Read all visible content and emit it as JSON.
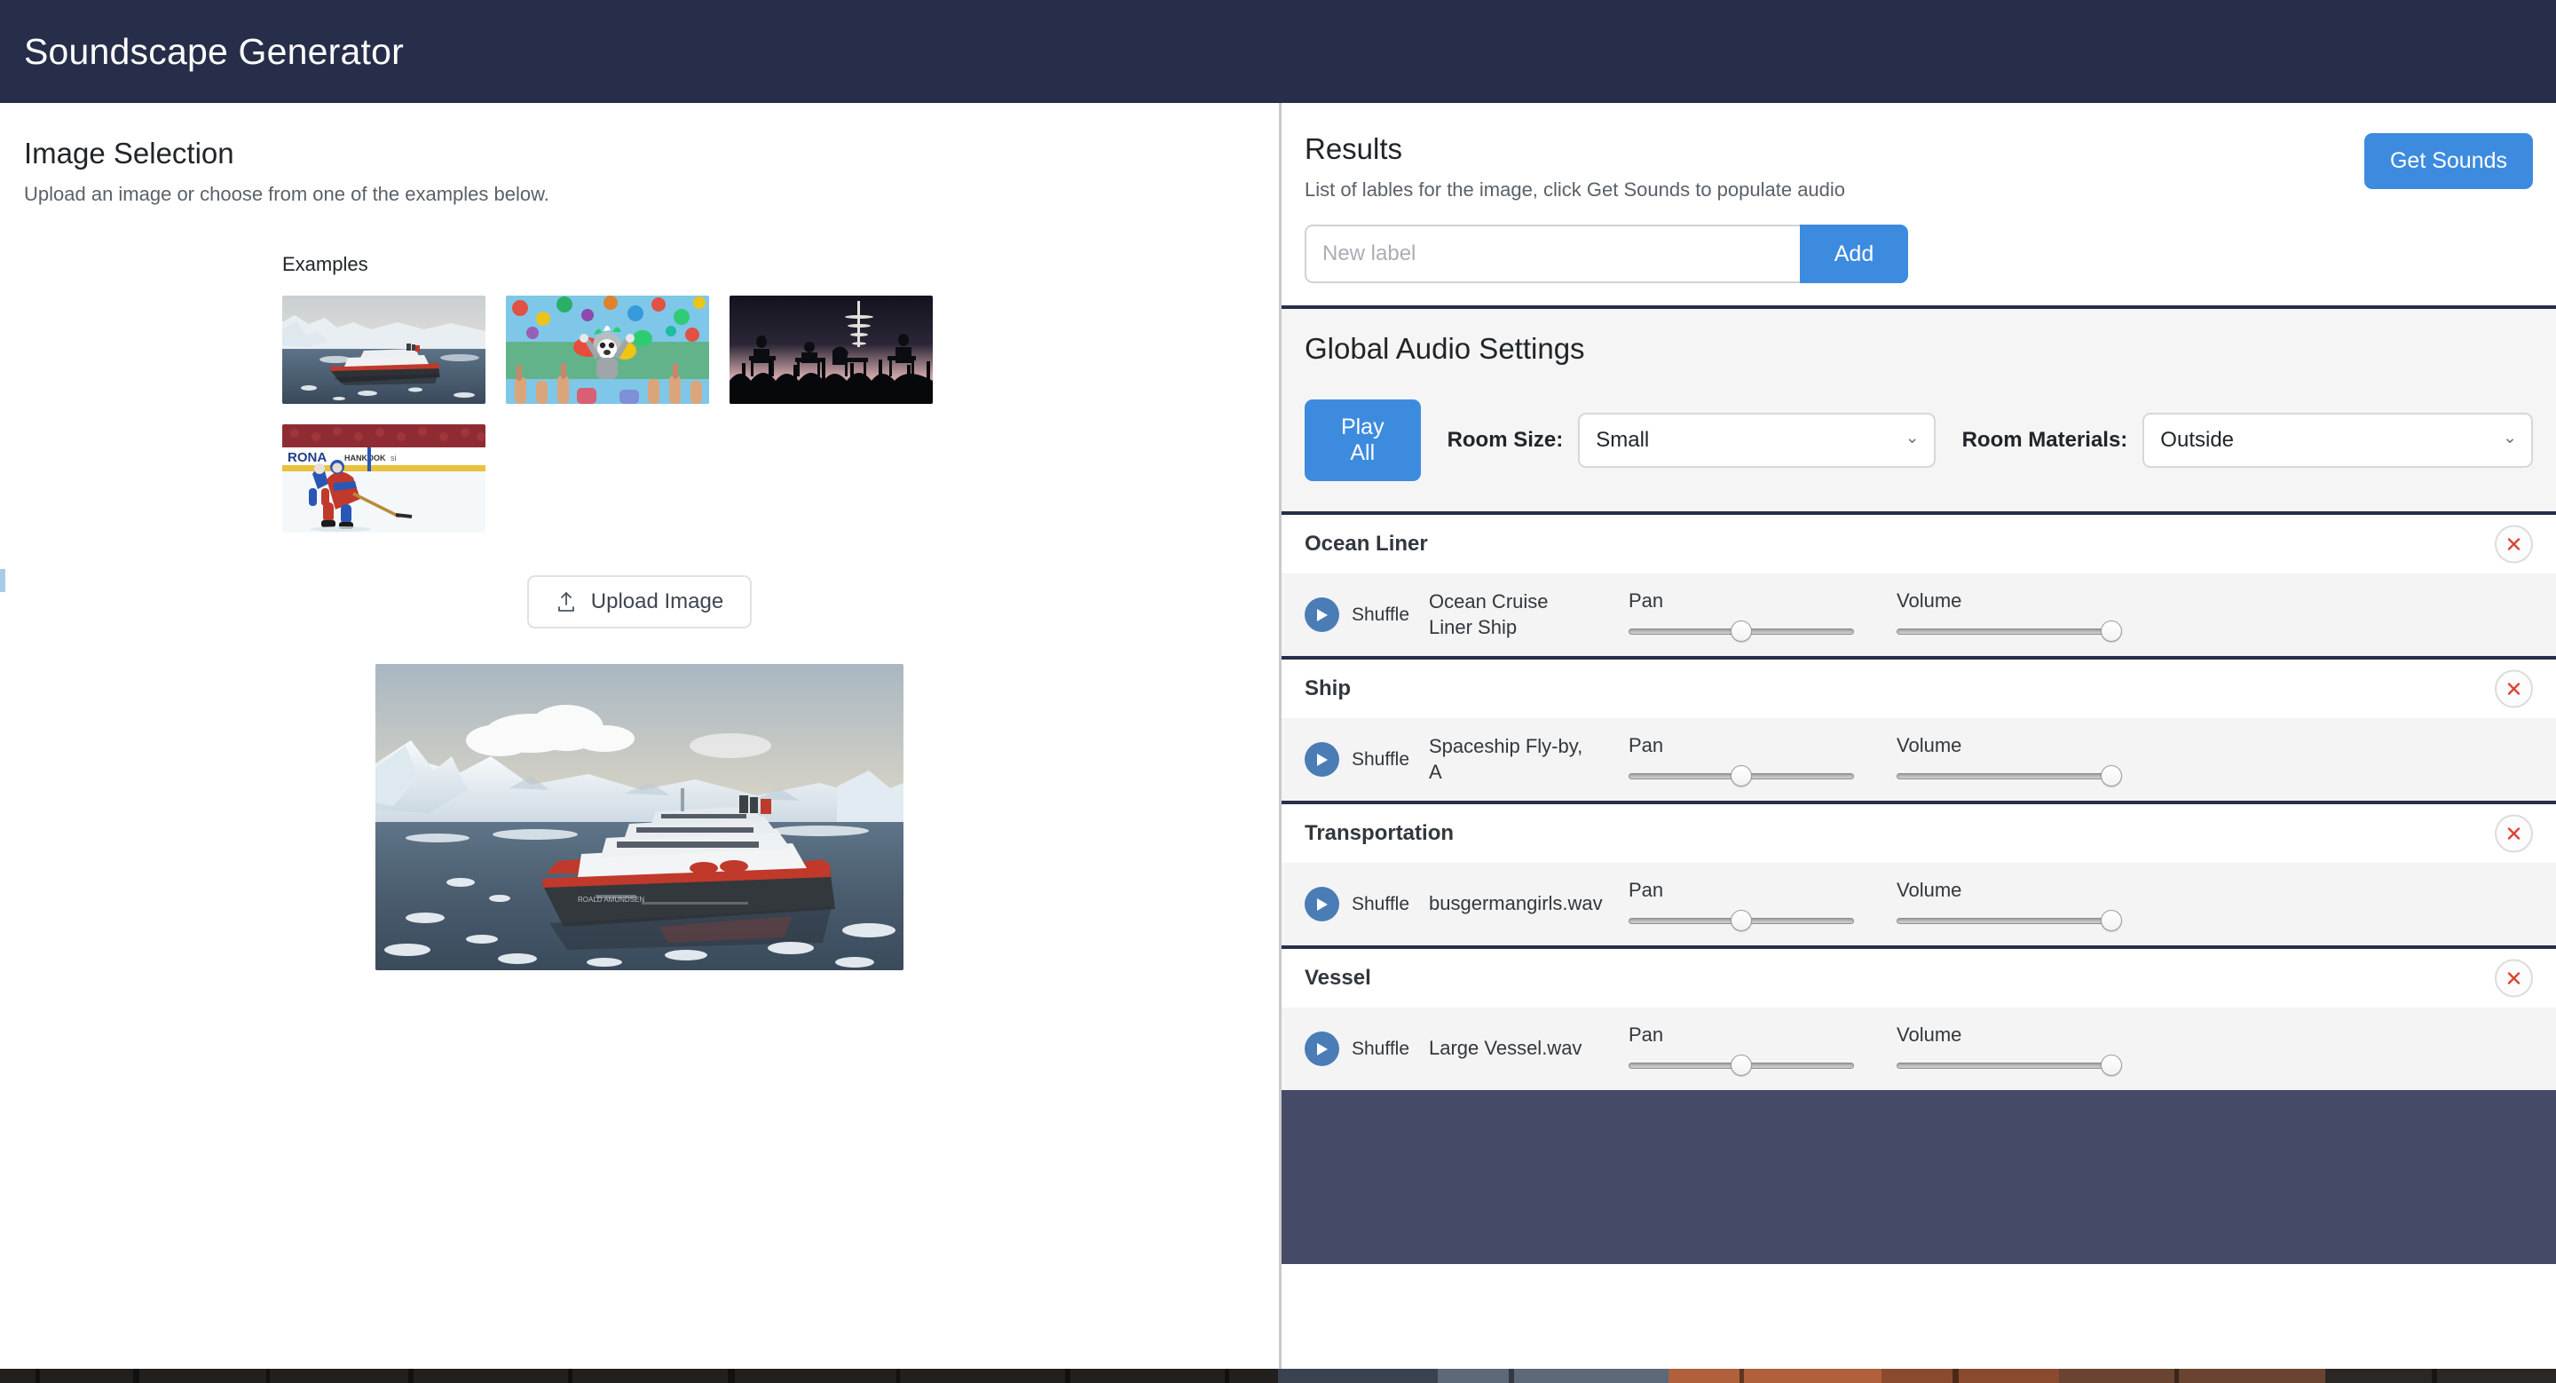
{
  "header": {
    "title": "Soundscape Generator",
    "background": "#272E4A"
  },
  "left_panel": {
    "title": "Image Selection",
    "subtitle": "Upload an image or choose from one of the examples below.",
    "examples_label": "Examples",
    "examples": [
      {
        "name": "example-cruise-ship",
        "alt": "Arctic cruise ship among icebergs"
      },
      {
        "name": "example-mascot-party",
        "alt": "Costumed lemur mascot with cheering kids and balloons"
      },
      {
        "name": "example-concert-crowd",
        "alt": "Concert stage silhouettes with crowd"
      },
      {
        "name": "example-hockey-game",
        "alt": "Ice hockey players on the rink"
      }
    ],
    "upload_button_label": "Upload Image",
    "upload_icon": "upload-icon",
    "preview": {
      "name": "preview-cruise-ship",
      "alt": "Arctic cruise ship among icebergs"
    }
  },
  "results": {
    "title": "Results",
    "subtitle": "List of lables for the image, click Get Sounds to populate audio",
    "get_sounds_label": "Get Sounds",
    "new_label_placeholder": "New label",
    "new_label_value": "",
    "add_label": "Add",
    "accent_color": "#3d8bdf"
  },
  "global_audio": {
    "title": "Global Audio Settings",
    "play_all_label": "Play All",
    "room_size_label": "Room Size:",
    "room_size_value": "Small",
    "room_size_options": [
      "Small"
    ],
    "room_materials_label": "Room Materials:",
    "room_materials_value": "Outside",
    "room_materials_options": [
      "Outside"
    ],
    "chevron_icon": "chevron-down-icon"
  },
  "sound_groups": [
    {
      "label": "Ocean Liner",
      "remove_icon": "close-icon",
      "sounds": [
        {
          "play_icon": "play-icon",
          "shuffle_label": "Shuffle",
          "name": "Ocean Cruise Liner Ship",
          "pan_label": "Pan",
          "pan_value": 50,
          "volume_label": "Volume",
          "volume_value": 100
        }
      ]
    },
    {
      "label": "Ship",
      "remove_icon": "close-icon",
      "sounds": [
        {
          "play_icon": "play-icon",
          "shuffle_label": "Shuffle",
          "name": "Spaceship Fly-by, A",
          "pan_label": "Pan",
          "pan_value": 50,
          "volume_label": "Volume",
          "volume_value": 100
        }
      ]
    },
    {
      "label": "Transportation",
      "remove_icon": "close-icon",
      "sounds": [
        {
          "play_icon": "play-icon",
          "shuffle_label": "Shuffle",
          "name": "busgermangirls.wav",
          "pan_label": "Pan",
          "pan_value": 50,
          "volume_label": "Volume",
          "volume_value": 100
        }
      ]
    },
    {
      "label": "Vessel",
      "remove_icon": "close-icon",
      "sounds": [
        {
          "play_icon": "play-icon",
          "shuffle_label": "Shuffle",
          "name": "Large Vessel.wav",
          "pan_label": "Pan",
          "pan_value": 50,
          "volume_label": "Volume",
          "volume_value": 100
        }
      ]
    }
  ]
}
